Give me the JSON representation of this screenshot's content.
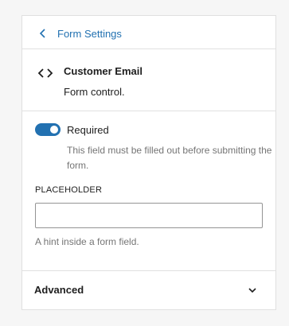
{
  "header": {
    "back_label": "Form Settings"
  },
  "block": {
    "title": "Customer Email",
    "description": "Form control."
  },
  "settings": {
    "required_label": "Required",
    "required_help": "This field must be filled out before submitting the form.",
    "placeholder_label": "PLACEHOLDER",
    "placeholder_value": "",
    "placeholder_help": "A hint inside a form field."
  },
  "advanced": {
    "label": "Advanced"
  },
  "colors": {
    "accent": "#2271b1",
    "text": "#1e1e1e",
    "muted": "#757575"
  },
  "icons": {
    "back": "chevron-left-icon",
    "block": "code-icon",
    "toggle": "toggle-on",
    "expand": "chevron-down-icon"
  }
}
